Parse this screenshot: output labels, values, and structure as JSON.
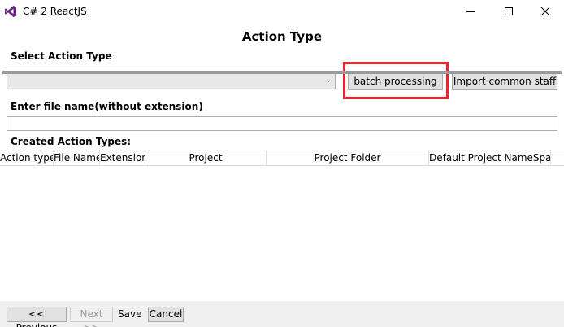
{
  "window": {
    "title": "C# 2 ReactJS",
    "icon": "visual-studio-icon",
    "controls": [
      "minimize-icon",
      "maximize-icon",
      "close-icon"
    ]
  },
  "heading": "Action Type",
  "select_action": {
    "label": "Select Action Type",
    "value": ""
  },
  "buttons": {
    "batch": "batch processing",
    "import": "Import common staff"
  },
  "filename": {
    "label": "Enter file name(without extension)",
    "value": ""
  },
  "created": {
    "label": "Created Action Types:",
    "columns": [
      "Action type",
      "File Name",
      "Extension",
      "Project",
      "Project Folder",
      "Default Project NameSpace"
    ],
    "rows": []
  },
  "footer": {
    "previous": "<< Previous",
    "next": "Next >>",
    "save": "Save",
    "cancel": "Cancel"
  },
  "colors": {
    "highlight": "#e8242c",
    "vs_purple": "#68217a"
  }
}
